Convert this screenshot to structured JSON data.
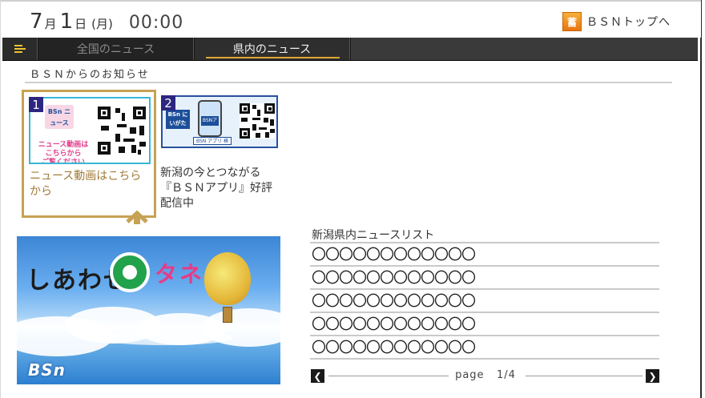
{
  "header": {
    "date": {
      "month": "7",
      "month_unit": "月",
      "day": "1",
      "day_unit": "日",
      "weekday": "(月)"
    },
    "time": "00:00",
    "top_link_icon_text": "蓄",
    "top_link_label": "ＢＳＮトップへ"
  },
  "tabs": [
    {
      "label": "全国のニュース",
      "active": false
    },
    {
      "label": "県内のニュース",
      "active": true
    }
  ],
  "notices": {
    "title": "ＢＳＮからのお知らせ",
    "items": [
      {
        "number": "1",
        "title": "ニュース動画はこちらから",
        "thumb_text": "ニュース動画は\nこちらから\nご覧ください",
        "thumb_logo": "BSn ニュース",
        "selected": true
      },
      {
        "number": "2",
        "title": "新潟の今とつながる『ＢＳＮアプリ』好評配信中",
        "thumb_logo": "BSn にいがた",
        "thumb_app": "BSNアプリ",
        "thumb_badge": "BSN アプリ 検索",
        "selected": false
      }
    ]
  },
  "banner": {
    "wordmark": "しあわせ",
    "wordmark2": "タネ",
    "logo": "BSn"
  },
  "news_list": {
    "title": "新潟県内ニュースリスト",
    "items": [
      "〇〇〇〇〇〇〇〇〇〇〇〇",
      "〇〇〇〇〇〇〇〇〇〇〇〇",
      "〇〇〇〇〇〇〇〇〇〇〇〇",
      "〇〇〇〇〇〇〇〇〇〇〇〇",
      "〇〇〇〇〇〇〇〇〇〇〇〇"
    ],
    "pager": {
      "label": "page",
      "current": "1",
      "sep": "/",
      "total": "4"
    }
  },
  "colors": {
    "accent_gold": "#c7a254",
    "tab_underline": "#e0a830",
    "badge_blue": "#2d2680",
    "top_button": "#f0902a"
  },
  "icons": {
    "menu": "hamburger-menu-icon",
    "prev": "chevron-left-icon",
    "next": "chevron-right-icon",
    "up": "chevron-up-icon"
  }
}
